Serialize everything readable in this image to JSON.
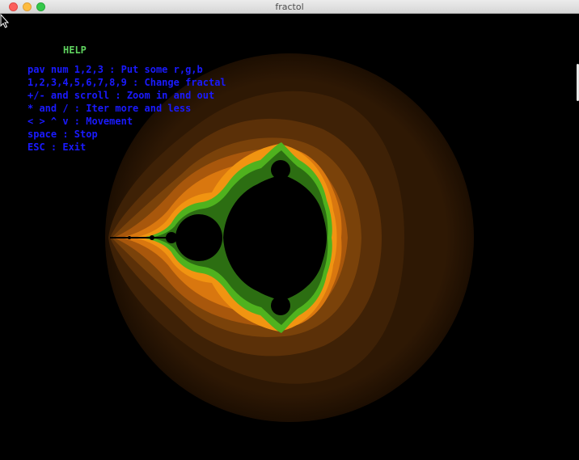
{
  "window": {
    "title": "fractol"
  },
  "help": {
    "title": "HELP",
    "lines": [
      "pav num 1,2,3 : Put some r,g,b",
      "1,2,3,4,5,6,7,8,9 : Change fractal",
      "+/- and scroll : Zoom in and out",
      "* and / : Iter more and less",
      "< > ^ v : Movement",
      "space : Stop",
      "ESC : Exit"
    ]
  },
  "colors": {
    "background": "#000000",
    "help_title": "#5fd35f",
    "help_text": "#1a1aff",
    "band_outer": "#2a1604",
    "band_2": "#3e2106",
    "band_3": "#5b3008",
    "band_4": "#7a420a",
    "band_5": "#a8570c",
    "band_6": "#d9770f",
    "band_7": "#f19411",
    "edge_green": "#4fb21e",
    "edge_dark_green": "#2c6e12"
  }
}
